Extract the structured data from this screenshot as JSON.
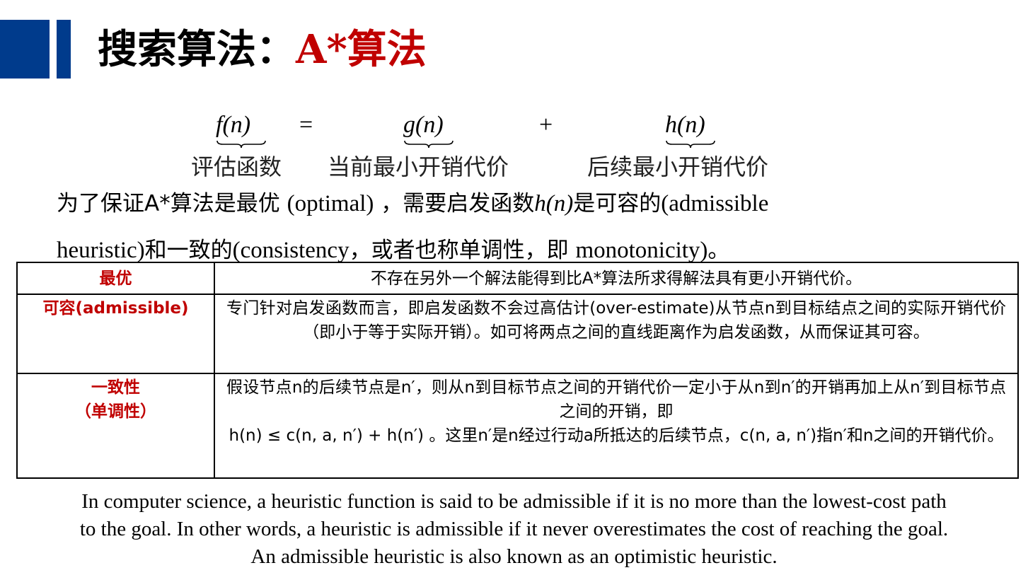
{
  "colors": {
    "accent": "#003b8c",
    "highlight": "#c00000",
    "text": "#000000"
  },
  "header": {
    "title_prefix": "搜索算法：",
    "title_highlight": "A*算法"
  },
  "formula": {
    "lhs": "f(n)",
    "equals": "=",
    "term1": "g(n)",
    "plus": "+",
    "term2": "h(n)",
    "lhs_label": "评估函数",
    "term1_label": "当前最小开销代价",
    "term2_label": "后续最小开销代价"
  },
  "intro": {
    "line1_a": "为了保证A*算法是最优",
    "line1_b": "(optimal)",
    "line1_c": "，需要启发函数",
    "line1_math": "h(n)",
    "line1_d": "是可容的",
    "line1_e": "(admissible",
    "line2_a": "heuristic)",
    "line2_b": "和一致的",
    "line2_c": "(consistency",
    "line2_d": "，或者也称单调性，即",
    "line2_e": "monotonicity)",
    "line2_f": "。"
  },
  "table": {
    "rows": [
      {
        "term": "最优",
        "def": "不存在另外一个解法能得到比A*算法所求得解法具有更小开销代价。"
      },
      {
        "term": "可容(admissible)",
        "def": "专门针对启发函数而言，即启发函数不会过高估计(over-estimate)从节点n到目标结点之间的实际开销代价（即小于等于实际开销）。如可将两点之间的直线距离作为启发函数，从而保证其可容。"
      },
      {
        "term": "一致性",
        "term2": "（单调性）",
        "def": "假设节点n的后续节点是n′，则从n到目标节点之间的开销代价一定小于从n到n′的开销再加上从n′到目标节点之间的开销，即",
        "def2": "h(n) ≤ c(n, a, n′) + h(n′) 。这里n′是n经过行动a所抵达的后续节点，c(n, a, n′)指n′和n之间的开销代价。"
      }
    ]
  },
  "footer": {
    "line1": "In computer science, a heuristic function is said to be admissible if it is no more than the lowest-cost path",
    "line2": "to the goal. In other words, a heuristic is admissible if it never overestimates the cost of reaching the goal.",
    "line3": "An admissible heuristic is also known as an optimistic heuristic."
  }
}
